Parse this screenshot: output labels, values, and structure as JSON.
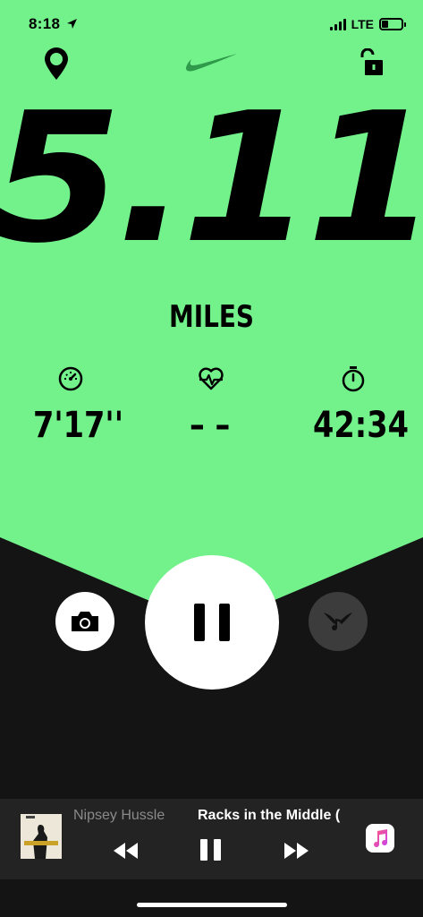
{
  "status_bar": {
    "time": "8:18",
    "network": "LTE",
    "battery_level": 0.35,
    "signal_bars": 4
  },
  "header": {
    "location_icon": "map-pin-icon",
    "logo": "nike-swoosh-icon",
    "lock_icon": "unlock-icon"
  },
  "run": {
    "distance": "5.11",
    "unit": "MILES",
    "pace": "7'17''",
    "heart_rate": "– –",
    "duration": "42:34"
  },
  "icons": {
    "pace": "speedometer-icon",
    "heart_rate": "heart-pulse-icon",
    "duration": "stopwatch-icon",
    "camera": "camera-icon",
    "pause": "pause-icon",
    "music": "winged-note-icon"
  },
  "now_playing": {
    "artist": "Nipsey Hussle",
    "title": "Racks in the Middle (",
    "app": "apple-music-icon"
  },
  "colors": {
    "accent_green": "#73f28c",
    "background": "#141414",
    "player_bar": "#232323"
  }
}
